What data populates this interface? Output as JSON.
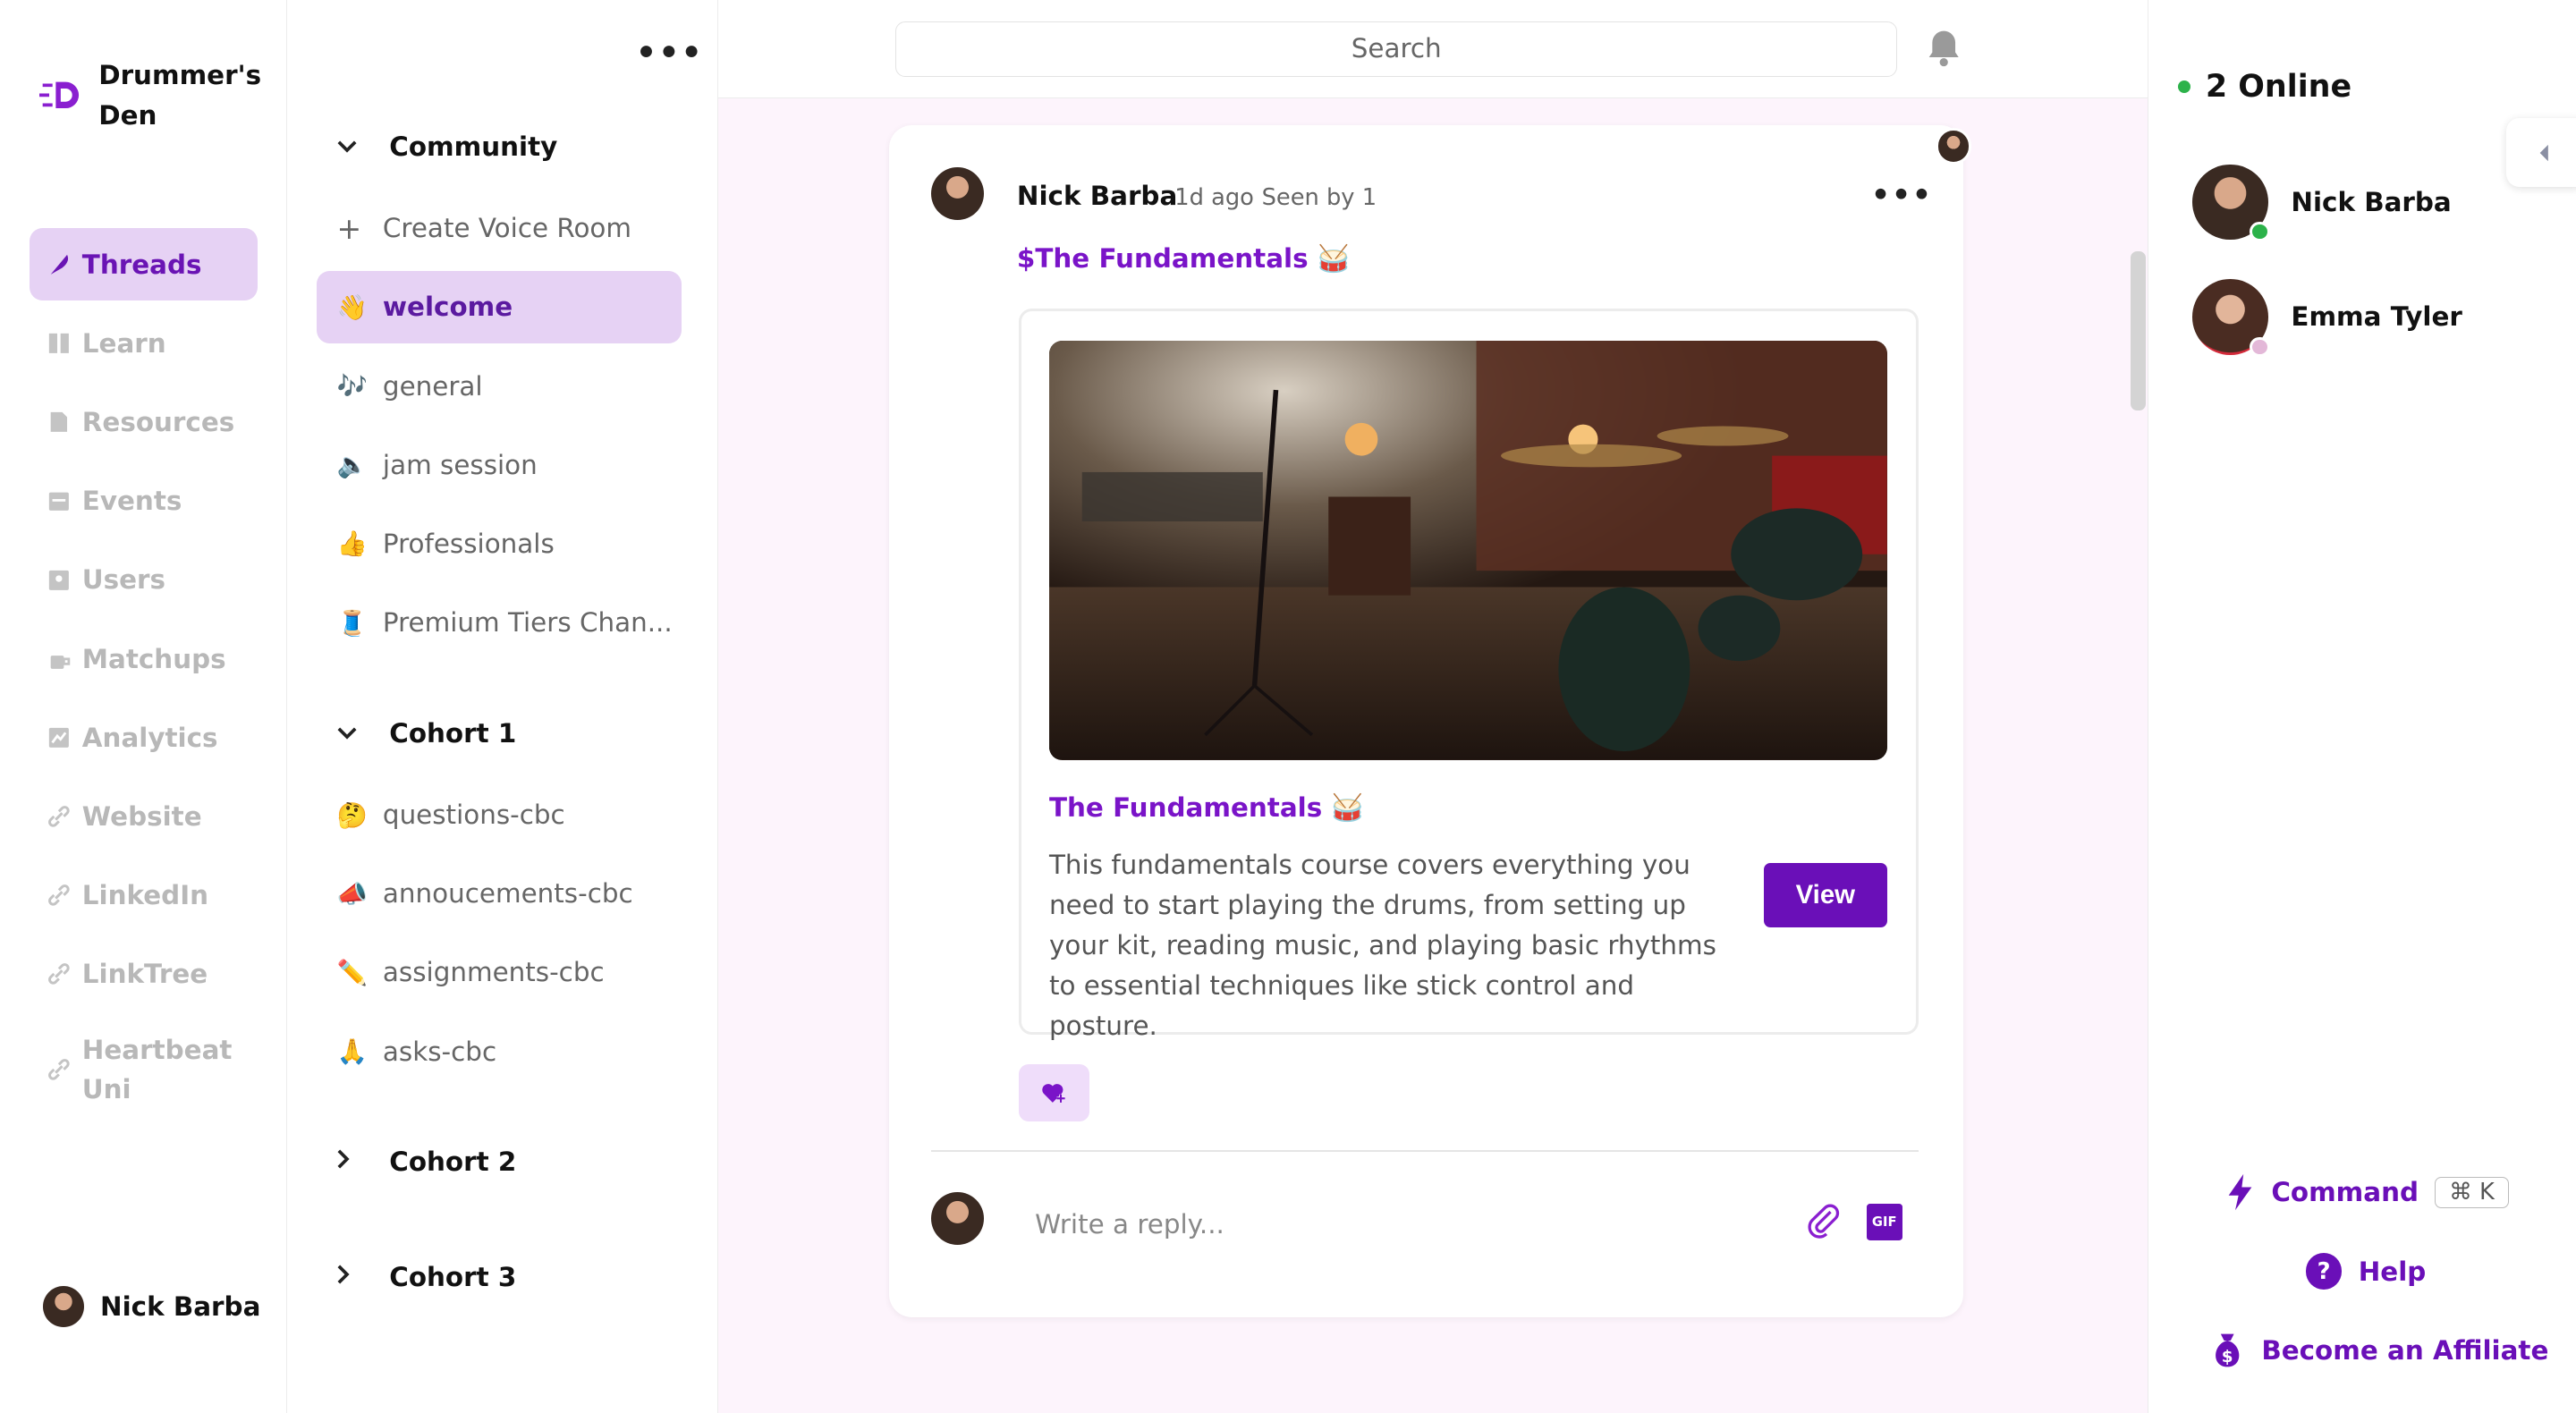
{
  "brand": {
    "name": "Drummer's Den",
    "accent": "#6a14b4"
  },
  "nav": {
    "items": [
      {
        "label": "Threads",
        "icon": "feather-icon",
        "active": true
      },
      {
        "label": "Learn",
        "icon": "book-icon"
      },
      {
        "label": "Resources",
        "icon": "file-icon"
      },
      {
        "label": "Events",
        "icon": "calendar-icon"
      },
      {
        "label": "Users",
        "icon": "user-card-icon"
      },
      {
        "label": "Matchups",
        "icon": "coffee-icon"
      },
      {
        "label": "Analytics",
        "icon": "chart-icon"
      },
      {
        "label": "Website",
        "icon": "link-icon"
      },
      {
        "label": "LinkedIn",
        "icon": "link-icon"
      },
      {
        "label": "LinkTree",
        "icon": "link-icon"
      },
      {
        "label": "Heartbeat Uni",
        "icon": "link-icon"
      }
    ],
    "current_user": "Nick Barba"
  },
  "channels": {
    "community": {
      "title": "Community",
      "create_label": "Create Voice Room",
      "items": [
        {
          "emoji": "👋",
          "label": "welcome",
          "active": true
        },
        {
          "emoji": "🎶",
          "label": "general"
        },
        {
          "emoji": "🔈",
          "label": "jam session"
        },
        {
          "emoji": "👍",
          "label": "Professionals"
        },
        {
          "emoji": "🧵",
          "label": "Premium Tiers Chan..."
        }
      ]
    },
    "cohort1": {
      "title": "Cohort 1",
      "items": [
        {
          "emoji": "🤔",
          "label": "questions-cbc"
        },
        {
          "emoji": "📣",
          "label": "annoucements-cbc"
        },
        {
          "emoji": "✏️",
          "label": "assignments-cbc"
        },
        {
          "emoji": "🙏",
          "label": "asks-cbc"
        }
      ]
    },
    "cohort2": {
      "title": "Cohort 2"
    },
    "cohort3": {
      "title": "Cohort 3"
    }
  },
  "search": {
    "placeholder": "Search"
  },
  "post": {
    "author": "Nick Barba",
    "time": "1d ago",
    "seen": "Seen by 1",
    "tag": "$The Fundamentals 🥁",
    "card": {
      "title": "The Fundamentals 🥁",
      "description": "This fundamentals course covers everything you need to start playing the drums, from setting up your kit, reading music, and playing basic rhythms to essential techniques like stick control and posture.",
      "view_label": "View"
    },
    "reply_placeholder": "Write a reply..."
  },
  "online": {
    "title": "2 Online",
    "members": [
      {
        "name": "Nick Barba",
        "status": "online",
        "status_color": "#2cb24a"
      },
      {
        "name": "Emma Tyler",
        "status": "away",
        "status_color": "#e3b8d8"
      }
    ]
  },
  "footer_links": {
    "command": "Command",
    "command_shortcut": "⌘ K",
    "help": "Help",
    "affiliate": "Become an Affiliate"
  }
}
